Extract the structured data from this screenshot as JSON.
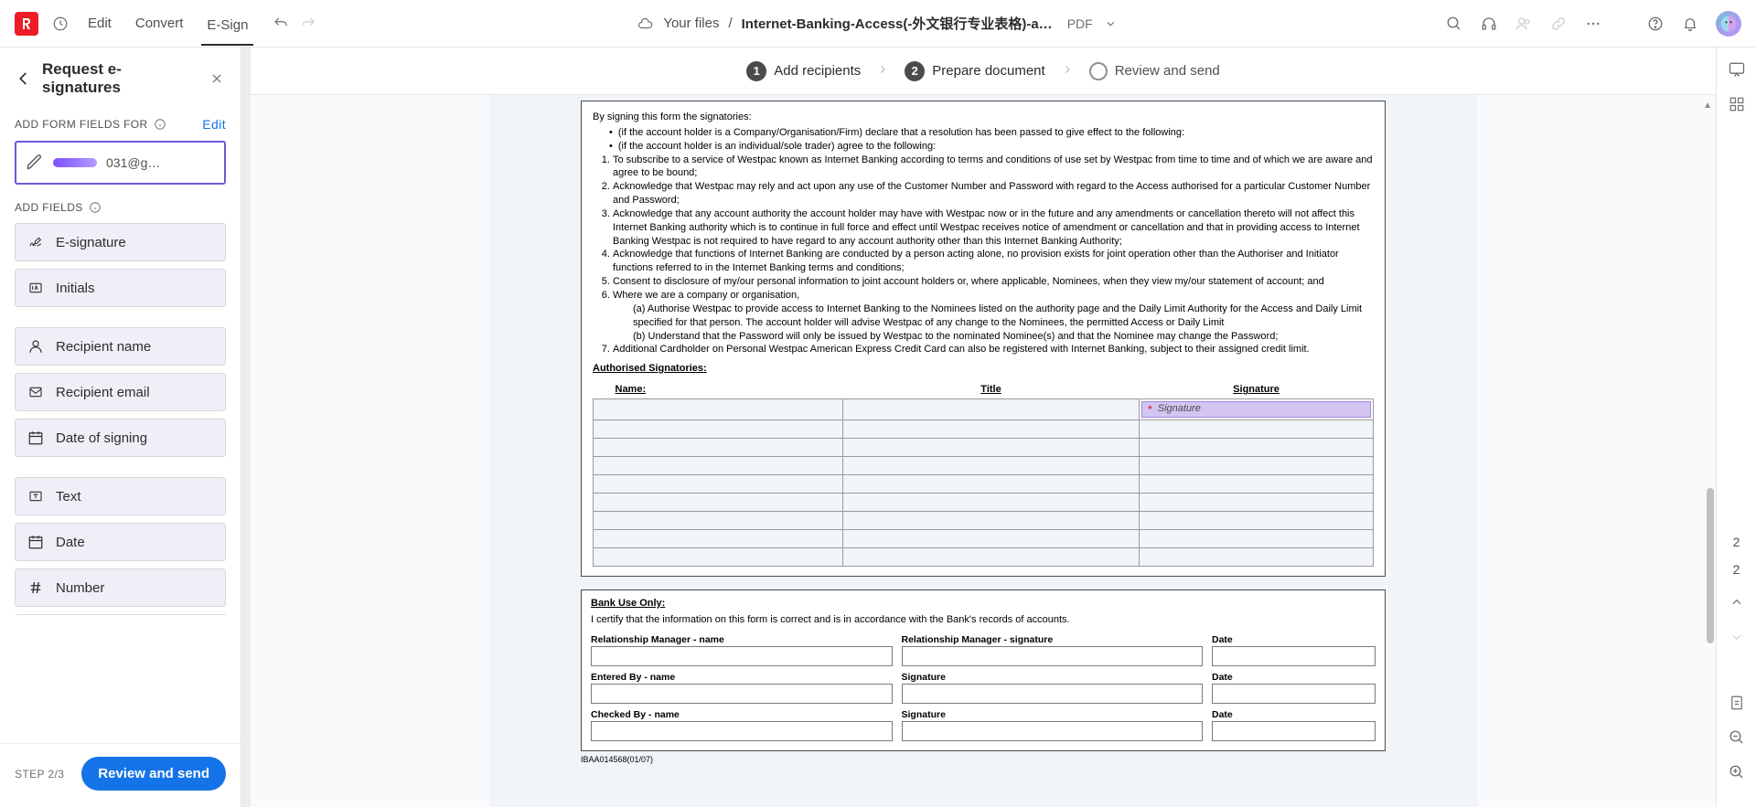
{
  "menubar": {
    "edit": "Edit",
    "convert": "Convert",
    "esign": "E-Sign",
    "breadcrumb_root": "Your files",
    "breadcrumb_sep": "/",
    "file_name": "Internet-Banking-Access(-外文银行专业表格)-a…",
    "file_type": "PDF"
  },
  "panel": {
    "title": "Request e-signatures",
    "add_form_fields_label": "ADD FORM FIELDS FOR",
    "edit_link": "Edit",
    "recipient_email_fragment": "031@g…",
    "add_fields_label": "ADD FIELDS",
    "fields": {
      "esignature": "E-signature",
      "initials": "Initials",
      "recipient_name": "Recipient name",
      "recipient_email": "Recipient email",
      "date_of_signing": "Date of signing",
      "text": "Text",
      "date": "Date",
      "number": "Number"
    },
    "step_indicator": "STEP 2/3",
    "review_btn": "Review and send"
  },
  "steps": {
    "s1": {
      "num": "1",
      "label": "Add recipients"
    },
    "s2": {
      "num": "2",
      "label": "Prepare document"
    },
    "s3": {
      "label": "Review and send"
    }
  },
  "document": {
    "terms": {
      "lead": "By signing this form the signatories:",
      "b1": "(if the account holder is a Company/Organisation/Firm) declare that a resolution has been passed to give effect to the following:",
      "b2": "(if the account holder is an individual/sole trader) agree to the following:",
      "n1": "To subscribe to a service of Westpac known as Internet Banking according to terms and conditions of use set by Westpac from time to time and of which we are aware and agree to be bound;",
      "n2": "Acknowledge that Westpac may rely and act upon any use of the Customer Number and Password with regard to the Access authorised for a particular Customer Number and Password;",
      "n3": "Acknowledge that any account authority the account holder may have with Westpac now or in the future and any amendments or cancellation thereto will not affect this Internet Banking authority  which is to  continue in full force and effect until Westpac receives notice of amendment or cancellation and that in providing access to Internet Banking Westpac is not required to have regard to any account authority other than this Internet Banking Authority;",
      "n4": "Acknowledge that functions of Internet Banking are conducted by a person acting alone, no provision exists for joint operation other than the Authoriser and Initiator functions referred to in the Internet Banking terms and conditions;",
      "n5": "Consent to disclosure of my/our personal information to joint account holders or, where applicable, Nominees, when they view my/our statement of account; and",
      "n6": "Where we are a company or organisation,",
      "n6a": "(a) Authorise Westpac to provide access to Internet Banking to the Nominees listed on the authority page and the Daily Limit Authority for the Access and Daily Limit specified for that person. The account holder will advise Westpac of any change to the Nominees, the permitted Access or Daily Limit",
      "n6b": "(b) Understand that the Password will only be issued by Westpac to the nominated Nominee(s) and that the Nominee may change the Password;",
      "n7": "Additional Cardholder on Personal Westpac American Express Credit Card can also be registered with Internet Banking, subject to their assigned credit limit.",
      "auth_sig": "Authorised Signatories:",
      "th_name": "Name:",
      "th_title": "Title",
      "th_sig": "Signature",
      "sig_placeholder": "Signature"
    },
    "bank": {
      "hdr": "Bank Use Only:",
      "cert": "I certify that the information on this form is correct and is in accordance with the Bank's records of accounts.",
      "rm_name": "Relationship Manager - name",
      "rm_sig": "Relationship Manager - signature",
      "date": "Date",
      "entered_by": "Entered By - name",
      "signature": "Signature",
      "checked_by": "Checked By - name"
    },
    "form_num": "IBAA014568(01/07)"
  },
  "rail": {
    "page_cur": "2",
    "page_total": "2"
  }
}
